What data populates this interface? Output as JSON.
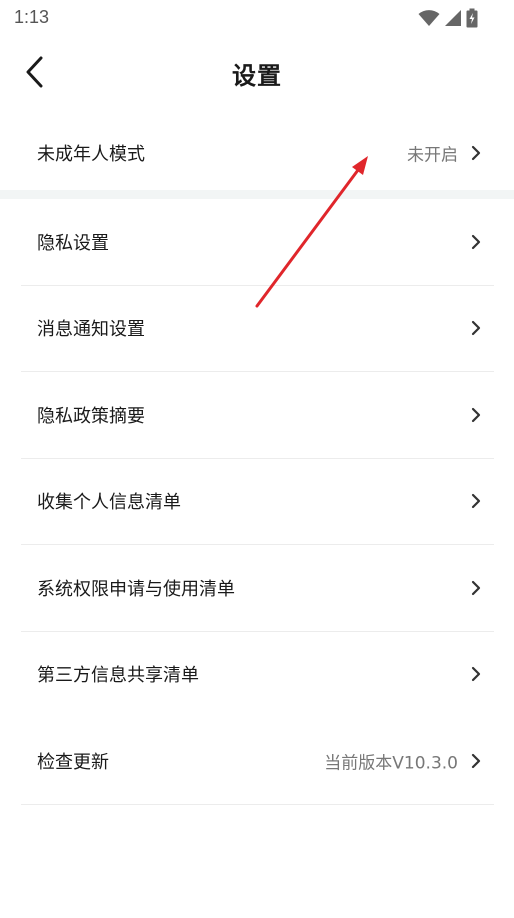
{
  "status_bar": {
    "time": "1:13",
    "icons": [
      "wifi-icon",
      "cellular-signal-icon",
      "battery-charging-icon"
    ]
  },
  "header": {
    "title": "设置",
    "back_icon": "back-arrow-icon"
  },
  "first_section": {
    "label": "未成年人模式",
    "value": "未开启"
  },
  "settings": {
    "items": [
      {
        "label": "隐私设置",
        "value": ""
      },
      {
        "label": "消息通知设置",
        "value": ""
      },
      {
        "label": "隐私政策摘要",
        "value": ""
      },
      {
        "label": "收集个人信息清单",
        "value": ""
      },
      {
        "label": "系统权限申请与使用清单",
        "value": ""
      },
      {
        "label": "第三方信息共享清单",
        "value": ""
      },
      {
        "label": "检查更新",
        "value": "当前版本V10.3.0"
      }
    ]
  },
  "colors": {
    "text_primary": "#1a1a1a",
    "text_secondary": "#777777",
    "divider": "#ececec",
    "section_gap": "#f2f5f5",
    "annotation_arrow": "#e0262b"
  }
}
